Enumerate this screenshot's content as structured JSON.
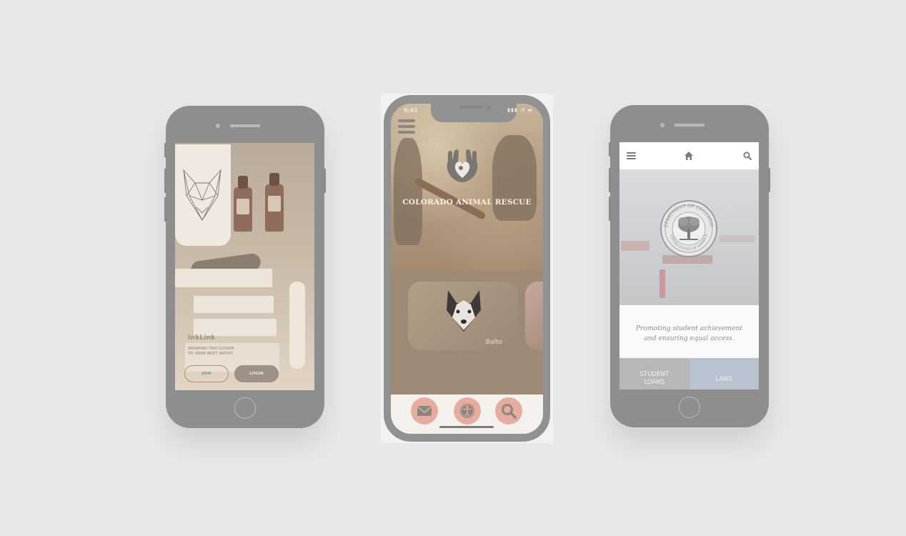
{
  "inklink": {
    "brand": "InkLink",
    "tagline_line1": "DRAWING YOU CLOSER",
    "tagline_line2": "TO YOUR NEXT ARTIST",
    "join_label": "JOIN",
    "login_label": "LOGIN"
  },
  "rescue": {
    "status_time": "9:41",
    "status_icons": "▮▮▮ ◔ ▬",
    "title": "COLORADO ANIMAL RESCUE",
    "pet_card_name": "Balto",
    "bottom_buttons": [
      "mail-icon",
      "accessibility-icon",
      "search-icon"
    ],
    "accent_color": "#e7aca0"
  },
  "education": {
    "nav_icons": [
      "menu-icon",
      "home-icon",
      "search-icon"
    ],
    "seal_top_text": "DEPARTMENT OF EDUCATION",
    "seal_bottom_text": "UNITED STATES OF AMERICA",
    "tagline_line1": "Promoting student achievement",
    "tagline_line2": "and ensuring equal access.",
    "tile_student_line1": "STUDENT",
    "tile_student_line2": "LOANS",
    "tile_laws": "LAWS"
  }
}
